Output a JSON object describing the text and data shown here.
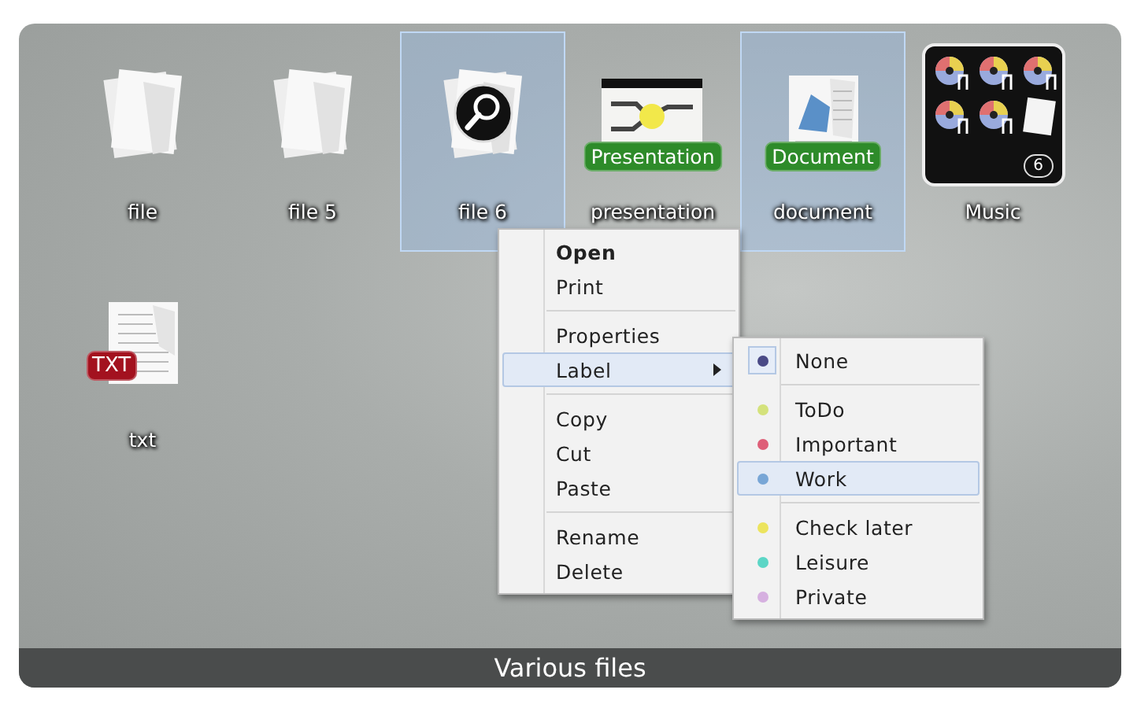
{
  "files": [
    {
      "name": "file",
      "kind": "pages",
      "selected": false
    },
    {
      "name": "file 5",
      "kind": "pages",
      "selected": false
    },
    {
      "name": "file 6",
      "kind": "search",
      "selected": true
    },
    {
      "name": "presentation",
      "kind": "presentation",
      "selected": false,
      "badge": {
        "text": "Presentation",
        "color": "#2e8b2a"
      }
    },
    {
      "name": "document",
      "kind": "document",
      "selected": true,
      "badge": {
        "text": "Document",
        "color": "#2e8b2a"
      }
    },
    {
      "name": "Music",
      "kind": "folder",
      "selected": false,
      "count": "6"
    },
    {
      "name": "txt",
      "kind": "text",
      "selected": false,
      "badge": {
        "text": "TXT",
        "color": "#a3121f"
      }
    }
  ],
  "context_menu": [
    {
      "kind": "item",
      "label": "Open",
      "default": true,
      "highlighted": false,
      "submenu": false
    },
    {
      "kind": "item",
      "label": "Print",
      "default": false,
      "highlighted": false,
      "submenu": false
    },
    {
      "kind": "separator"
    },
    {
      "kind": "item",
      "label": "Properties",
      "default": false,
      "highlighted": false,
      "submenu": false
    },
    {
      "kind": "item",
      "label": "Label",
      "default": false,
      "highlighted": true,
      "submenu": true
    },
    {
      "kind": "separator"
    },
    {
      "kind": "item",
      "label": "Copy",
      "default": false,
      "highlighted": false,
      "submenu": false
    },
    {
      "kind": "item",
      "label": "Cut",
      "default": false,
      "highlighted": false,
      "submenu": false
    },
    {
      "kind": "item",
      "label": "Paste",
      "default": false,
      "highlighted": false,
      "submenu": false
    },
    {
      "kind": "separator"
    },
    {
      "kind": "item",
      "label": "Rename",
      "default": false,
      "highlighted": false,
      "submenu": false
    },
    {
      "kind": "item",
      "label": "Delete",
      "default": false,
      "highlighted": false,
      "submenu": false
    }
  ],
  "label_submenu": [
    {
      "kind": "item",
      "label": "None",
      "color": "#4a4a86",
      "checked": true,
      "highlighted": false
    },
    {
      "kind": "separator"
    },
    {
      "kind": "item",
      "label": "ToDo",
      "color": "#d4e27c",
      "checked": false,
      "highlighted": false
    },
    {
      "kind": "item",
      "label": "Important",
      "color": "#de5f78",
      "checked": false,
      "highlighted": false
    },
    {
      "kind": "item",
      "label": "Work",
      "color": "#78a6d6",
      "checked": false,
      "highlighted": true
    },
    {
      "kind": "separator"
    },
    {
      "kind": "item",
      "label": "Check later",
      "color": "#ece45e",
      "checked": false,
      "highlighted": false
    },
    {
      "kind": "item",
      "label": "Leisure",
      "color": "#5cd6c6",
      "checked": false,
      "highlighted": false
    },
    {
      "kind": "item",
      "label": "Private",
      "color": "#d6b0e0",
      "checked": false,
      "highlighted": false
    }
  ],
  "status_bar": {
    "title": "Various files"
  }
}
